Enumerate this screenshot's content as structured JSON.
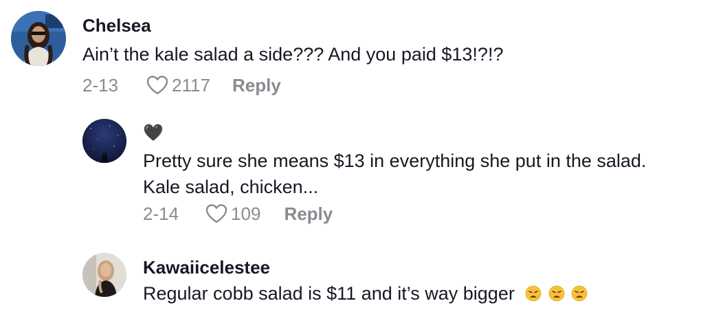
{
  "comments": [
    {
      "username": "Chelsea",
      "text": "Ain’t the kale salad a side??? And you paid $13!?!?",
      "date": "2-13",
      "likes": "2117",
      "reply_label": "Reply",
      "avatar_icon": "user-photo-avatar"
    },
    {
      "username": "🖤",
      "text_line1": "Pretty sure she means $13 in everything she put in the salad.",
      "text_line2": "Kale salad, chicken...",
      "date": "2-14",
      "likes": "109",
      "reply_label": "Reply",
      "avatar_icon": "night-sky-avatar"
    },
    {
      "username": "Kawaiicelestee",
      "text": "Regular cobb salad is $11 and it’s way bigger",
      "emojis": [
        "weary-face-emoji",
        "weary-face-emoji",
        "weary-face-emoji"
      ],
      "avatar_icon": "user-photo-avatar"
    }
  ],
  "colors": {
    "primary_text": "#161823",
    "secondary_text": "#8a8b91",
    "background": "#ffffff"
  }
}
